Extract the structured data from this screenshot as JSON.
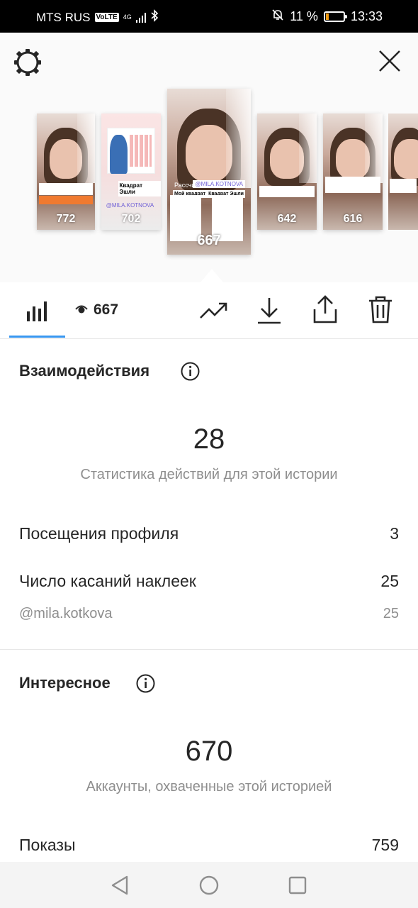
{
  "status_bar": {
    "carrier": "MTS RUS",
    "volte": "VoLTE",
    "network": "4G",
    "battery_percent": "11 %",
    "battery_level": 0.11,
    "time": "13:33",
    "colors": {
      "background": "#000000",
      "battery_fill": "#f39c12"
    }
  },
  "header": {
    "settings_icon": "gear-icon",
    "close_icon": "close-icon"
  },
  "stories": [
    {
      "views": "772",
      "selected": false
    },
    {
      "views": "702",
      "selected": false,
      "sticker": "Квадрат Эшли",
      "mention": "@MILA.KOTNOVA"
    },
    {
      "views": "667",
      "selected": true,
      "calc": "Рассчитала :",
      "mention": "@MILA.KOTNOVA",
      "label_left": "Мой квадрат",
      "label_right": "Квадрат Эшли"
    },
    {
      "views": "642",
      "selected": false
    },
    {
      "views": "616",
      "selected": false
    },
    {
      "views": "",
      "selected": false
    }
  ],
  "toolbar": {
    "insights_icon": "bar-chart-icon",
    "views_icon": "eye-icon",
    "views_count": "667",
    "promote_icon": "trending-up-icon",
    "download_icon": "download-icon",
    "share_icon": "share-icon",
    "delete_icon": "trash-icon",
    "accent": "#3897f0"
  },
  "interactions": {
    "title": "Взаимодействия",
    "total": "28",
    "subtitle": "Статистика действий для этой истории",
    "rows": [
      {
        "label": "Посещения профиля",
        "value": "3"
      },
      {
        "label": "Число касаний наклеек",
        "value": "25"
      }
    ],
    "sub_rows": [
      {
        "label": "@mila.kotkova",
        "value": "25"
      }
    ]
  },
  "discovery": {
    "title": "Интересное",
    "total": "670",
    "subtitle": "Аккаунты, охваченные этой историей",
    "rows": [
      {
        "label": "Показы",
        "value": "759"
      }
    ]
  },
  "nav": {
    "back_icon": "back-triangle-icon",
    "home_icon": "home-circle-icon",
    "recents_icon": "recents-square-icon"
  }
}
